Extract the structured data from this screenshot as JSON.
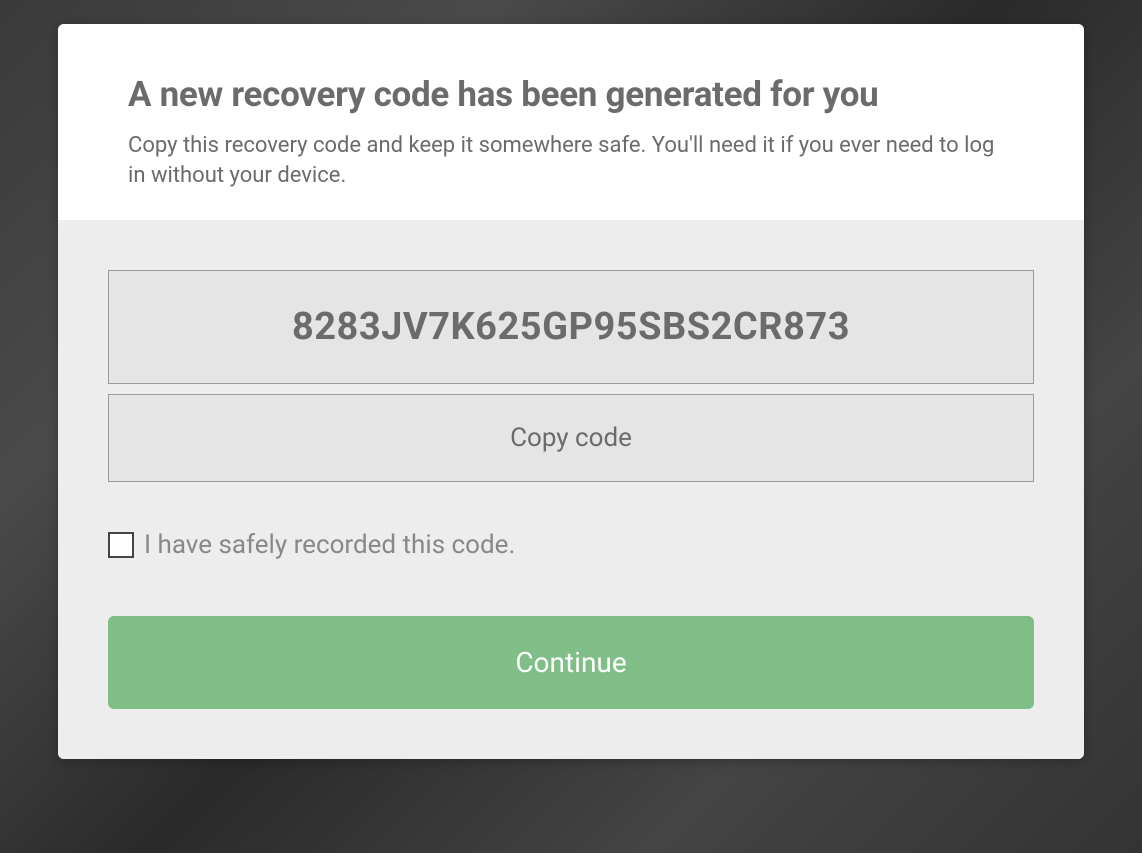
{
  "header": {
    "title": "A new recovery code has been generated for you",
    "subtitle": "Copy this recovery code and keep it somewhere safe. You'll need it if you ever need to log in without your device."
  },
  "recovery": {
    "code": "8283JV7K625GP95SBS2CR873",
    "copy_label": "Copy code",
    "checkbox_label": "I have safely recorded this code.",
    "continue_label": "Continue"
  },
  "colors": {
    "accent": "#80be87",
    "text_muted": "#6b6b6b"
  }
}
